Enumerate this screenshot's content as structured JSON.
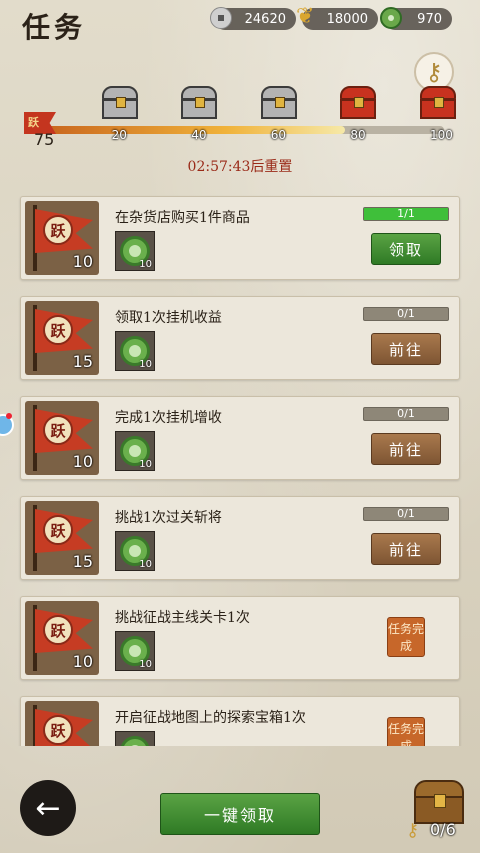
{
  "header": {
    "title": "任务"
  },
  "resources": [
    {
      "icon": "copper-coin-icon",
      "value": "24620"
    },
    {
      "icon": "wheat-icon",
      "value": "18000"
    },
    {
      "icon": "jade-icon",
      "value": "970"
    }
  ],
  "activity": {
    "current_level": "75",
    "banner_glyph": "跃",
    "progress_percent": 75,
    "milestones": [
      {
        "label": "20",
        "chest": "silver"
      },
      {
        "label": "40",
        "chest": "silver"
      },
      {
        "label": "60",
        "chest": "silver"
      },
      {
        "label": "80",
        "chest": "red"
      },
      {
        "label": "100",
        "chest": "red"
      }
    ],
    "reset_text": "02:57:43后重置"
  },
  "quests": [
    {
      "name": "在杂货店购买1件商品",
      "points": "10",
      "reward": "10",
      "progress": "1/1",
      "progress_fraction": 1,
      "action": "领取",
      "state": "claim"
    },
    {
      "name": "领取1次挂机收益",
      "points": "15",
      "reward": "10",
      "progress": "0/1",
      "progress_fraction": 0,
      "action": "前往",
      "state": "go"
    },
    {
      "name": "完成1次挂机增收",
      "points": "10",
      "reward": "10",
      "progress": "0/1",
      "progress_fraction": 0,
      "action": "前往",
      "state": "go"
    },
    {
      "name": "挑战1次过关斩将",
      "points": "15",
      "reward": "10",
      "progress": "0/1",
      "progress_fraction": 0,
      "action": "前往",
      "state": "go"
    },
    {
      "name": "挑战征战主线关卡1次",
      "points": "10",
      "reward": "10",
      "progress": "",
      "progress_fraction": 0,
      "action": "任务完成",
      "state": "done"
    },
    {
      "name": "开启征战地图上的探索宝箱1次",
      "points": "10",
      "reward": "10",
      "progress": "",
      "progress_fraction": 0,
      "action": "任务完成",
      "state": "done"
    }
  ],
  "footer": {
    "claim_all": "一键领取",
    "chest_count": "0/6"
  },
  "colors": {
    "accent_green": "#3fbf3a",
    "progress_orange": "#f0b23a",
    "banner_red": "#c63c23"
  }
}
